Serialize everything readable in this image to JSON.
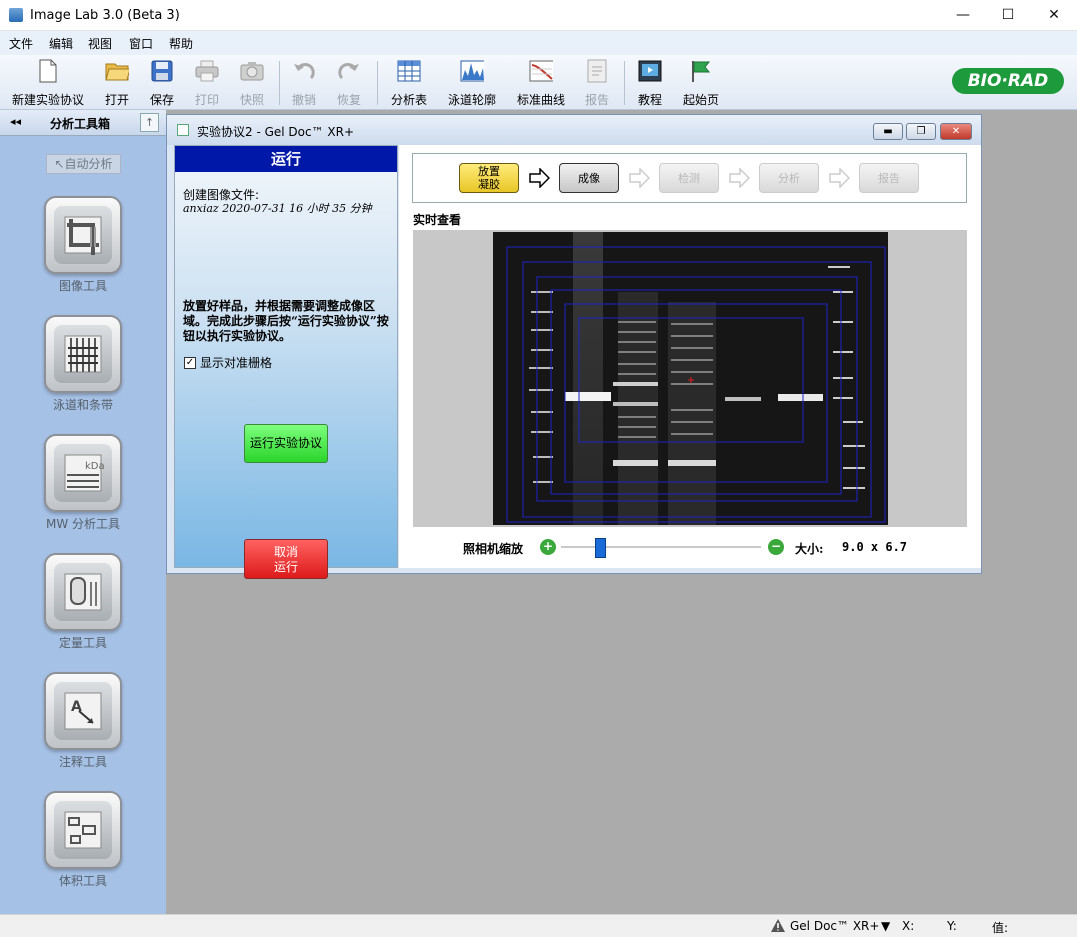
{
  "window": {
    "title": "Image Lab 3.0 (Beta 3)",
    "min_label": "—",
    "max_label": "☐",
    "close_label": "✕"
  },
  "menu": [
    "文件",
    "编辑",
    "视图",
    "窗口",
    "帮助"
  ],
  "toolbar": {
    "items": [
      {
        "label": "新建实验协议",
        "icon": "new-document-icon",
        "enabled": true
      },
      {
        "label": "打开",
        "icon": "folder-open-icon",
        "enabled": true
      },
      {
        "label": "保存",
        "icon": "save-icon",
        "enabled": true
      },
      {
        "label": "打印",
        "icon": "printer-icon",
        "enabled": false
      },
      {
        "label": "快照",
        "icon": "camera-icon",
        "enabled": false
      },
      {
        "label": "撤销",
        "icon": "undo-icon",
        "enabled": false
      },
      {
        "label": "恢复",
        "icon": "redo-icon",
        "enabled": false
      },
      {
        "label": "分析表",
        "icon": "table-icon",
        "enabled": true
      },
      {
        "label": "泳道轮廓",
        "icon": "lane-profile-icon",
        "enabled": true
      },
      {
        "label": "标准曲线",
        "icon": "standard-curve-icon",
        "enabled": true
      },
      {
        "label": "报告",
        "icon": "report-icon",
        "enabled": false
      },
      {
        "label": "教程",
        "icon": "tutorial-icon",
        "enabled": true
      },
      {
        "label": "起始页",
        "icon": "start-page-flag-icon",
        "enabled": true
      }
    ],
    "brand": "BIO·RAD",
    "brand_color": "#1d9a3c"
  },
  "sidebar": {
    "collapse": "◂◂",
    "title": "分析工具箱",
    "up": "↑",
    "auto_analyze": "↖自动分析",
    "tools": [
      {
        "label": "图像工具",
        "icon": "image-crop-tool-icon"
      },
      {
        "label": "泳道和条带",
        "icon": "lanes-bands-icon"
      },
      {
        "label": "MW 分析工具",
        "icon": "mw-analysis-icon"
      },
      {
        "label": "定量工具",
        "icon": "quantity-tool-icon"
      },
      {
        "label": "注释工具",
        "icon": "annotation-tool-icon"
      },
      {
        "label": "体积工具",
        "icon": "volume-tool-icon"
      }
    ]
  },
  "child_window": {
    "title": "实验协议2 - Gel Doc™ XR+",
    "run_panel": {
      "header": "运行",
      "created_label": "创建图像文件:",
      "created_value": "anxiaz 2020-07-31 16 小时 35 分钟",
      "instruction": "放置好样品，并根据需要调整成像区域。完成此步骤后按“运行实验协议”按钮以执行实验协议。",
      "grid_checkbox": "显示对准栅格",
      "grid_checked": true,
      "run_button": "运行实验协议",
      "cancel_button": "取消\n运行"
    },
    "steps": [
      {
        "label": "放置\n凝胶",
        "state": "active"
      },
      {
        "label": "成像",
        "state": "current"
      },
      {
        "label": "检测",
        "state": "disabled"
      },
      {
        "label": "分析",
        "state": "disabled"
      },
      {
        "label": "报告",
        "state": "disabled"
      }
    ],
    "live_label": "实时查看",
    "zoom_label": "照相机缩放",
    "size_label": "大小:",
    "size_value": "9.0 x 6.7"
  },
  "statusbar": {
    "device": "Gel Doc™ XR+",
    "x_label": "X:",
    "y_label": "Y:",
    "value_label": "值:"
  }
}
